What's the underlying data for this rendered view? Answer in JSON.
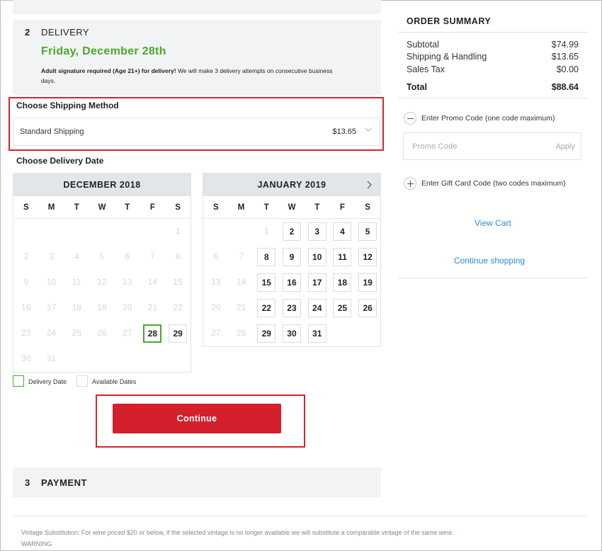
{
  "top_snippet": "",
  "delivery": {
    "step_number": "2",
    "step_title": "DELIVERY",
    "date": "Friday, December 28th",
    "note_bold": "Adult signature required (Age 21+) for delivery!",
    "note_rest": " We will make 3 delivery attempts on consecutive business days."
  },
  "shipping": {
    "label": "Choose Shipping Method",
    "selected_method": "Standard Shipping",
    "selected_price": "$13.65"
  },
  "delivery_date": {
    "label": "Choose Delivery Date"
  },
  "calendars": [
    {
      "month": "DECEMBER 2018",
      "weekdays": [
        "S",
        "M",
        "T",
        "W",
        "T",
        "F",
        "S"
      ],
      "leading_blanks": 6,
      "days": [
        1,
        2,
        3,
        4,
        5,
        6,
        7,
        8,
        9,
        10,
        11,
        12,
        13,
        14,
        15,
        16,
        17,
        18,
        19,
        20,
        21,
        22,
        23,
        24,
        25,
        26,
        27,
        28,
        29,
        30,
        31
      ],
      "available": [
        28,
        29
      ],
      "selected": 28
    },
    {
      "month": "JANUARY 2019",
      "weekdays": [
        "S",
        "M",
        "T",
        "W",
        "T",
        "F",
        "S"
      ],
      "leading_blanks": 2,
      "days": [
        1,
        2,
        3,
        4,
        5,
        6,
        7,
        8,
        9,
        10,
        11,
        12,
        13,
        14,
        15,
        16,
        17,
        18,
        19,
        20,
        21,
        22,
        23,
        24,
        25,
        26,
        27,
        28,
        29,
        30,
        31
      ],
      "available": [
        2,
        3,
        4,
        5,
        8,
        9,
        10,
        11,
        12,
        15,
        16,
        17,
        18,
        19,
        22,
        23,
        24,
        25,
        26,
        29,
        30,
        31
      ],
      "selected": null,
      "has_next": true
    }
  ],
  "legend": {
    "delivery_date": "Delivery Date",
    "available_dates": "Available Dates"
  },
  "continue_label": "Continue",
  "payment": {
    "step_number": "3",
    "step_title": "PAYMENT"
  },
  "footer": {
    "line1": "Vintage Substitution: For wine priced $20 or below, if the selected vintage is no longer available we will substitute a comparable vintage of the same wine.",
    "line2": "WARNING"
  },
  "summary": {
    "title": "ORDER SUMMARY",
    "rows": [
      {
        "label": "Subtotal",
        "value": "$74.99"
      },
      {
        "label": "Shipping & Handling",
        "value": "$13.65"
      },
      {
        "label": "Sales Tax",
        "value": "$0.00"
      }
    ],
    "total_label": "Total",
    "total_value": "$88.64",
    "promo_toggle": "Enter Promo Code (one code maximum)",
    "promo_placeholder": "Promo Code",
    "apply_label": "Apply",
    "gift_toggle": "Enter Gift Card Code (two codes maximum)",
    "view_cart": "View Cart",
    "continue_shopping": "Continue shopping"
  },
  "colors": {
    "accent_red": "#d51f2c",
    "delivery_green": "#49a82a",
    "link_blue": "#2d8bd4",
    "panel_grey": "#f2f3f4"
  }
}
